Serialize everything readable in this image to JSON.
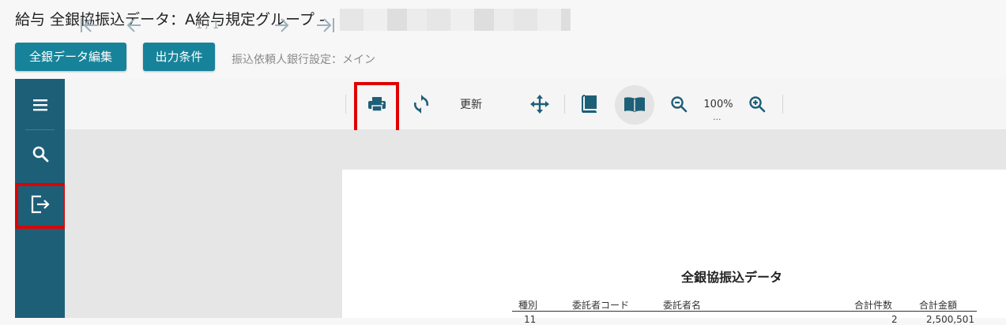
{
  "page": {
    "title": "給与 全銀協振込データ：A給与規定グループ -",
    "buttons": {
      "edit": "全銀データ編集",
      "conditions": "出力条件"
    },
    "bank_setting": "振込依頼人銀行設定：メイン"
  },
  "viewer": {
    "sidebar": {
      "items": [
        {
          "icon": "menu-icon"
        },
        {
          "icon": "search-icon"
        },
        {
          "icon": "export-icon",
          "highlighted": true
        }
      ]
    },
    "toolbar": {
      "page_indicator": "1 / 1",
      "refresh_label": "更新",
      "zoom_level": "100%",
      "zoom_more": "...",
      "icons": [
        "first-page-icon",
        "prev-page-icon",
        "next-page-icon",
        "last-page-icon",
        "print-icon",
        "refresh-icon",
        "move-icon",
        "continuous-view-icon",
        "book-view-icon",
        "zoom-out-icon",
        "zoom-in-icon"
      ],
      "highlight_color": "#e00000"
    },
    "document": {
      "title": "全銀協振込データ",
      "columns": [
        "種別",
        "委託者コード",
        "委託者名",
        "合計件数",
        "合計金額"
      ],
      "first_row_partial": [
        "11",
        "2",
        "2,500,501"
      ]
    }
  },
  "colors": {
    "accent": "#16839a",
    "sidebar": "#1e5f78",
    "highlight": "#e00000"
  }
}
